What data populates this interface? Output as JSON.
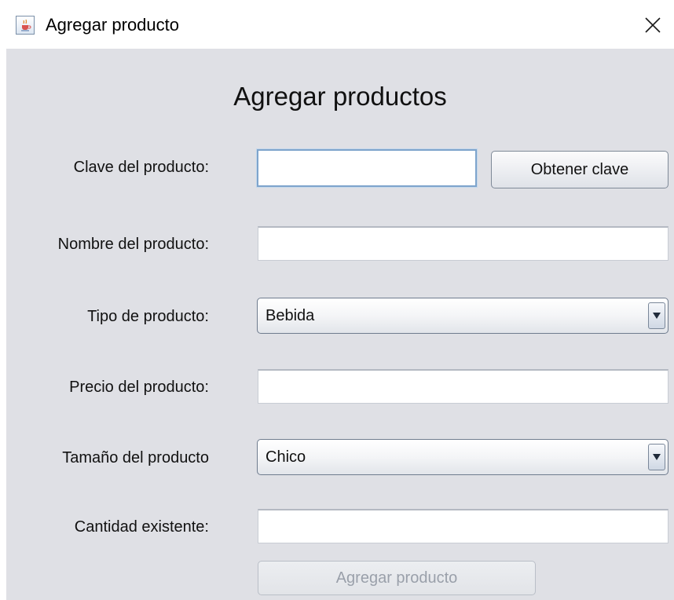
{
  "window": {
    "title": "Agregar producto",
    "icon": "java-cup-icon",
    "close_icon": "close-icon"
  },
  "form": {
    "heading": "Agregar productos",
    "clave_label": "Clave del producto:",
    "clave_value": "",
    "obtener_clave_label": "Obtener clave",
    "nombre_label": "Nombre del producto:",
    "nombre_value": "",
    "tipo_label": "Tipo de producto:",
    "tipo_selected": "Bebida",
    "precio_label": "Precio del producto:",
    "precio_value": "",
    "tamano_label": "Tamaño del producto",
    "tamano_selected": "Chico",
    "cantidad_label": "Cantidad existente:",
    "cantidad_value": "",
    "agregar_label": "Agregar producto"
  },
  "colors": {
    "panel_background": "#dfe0e5",
    "focus_border": "#7ea4cc",
    "disabled_text": "#9aa0aa"
  }
}
